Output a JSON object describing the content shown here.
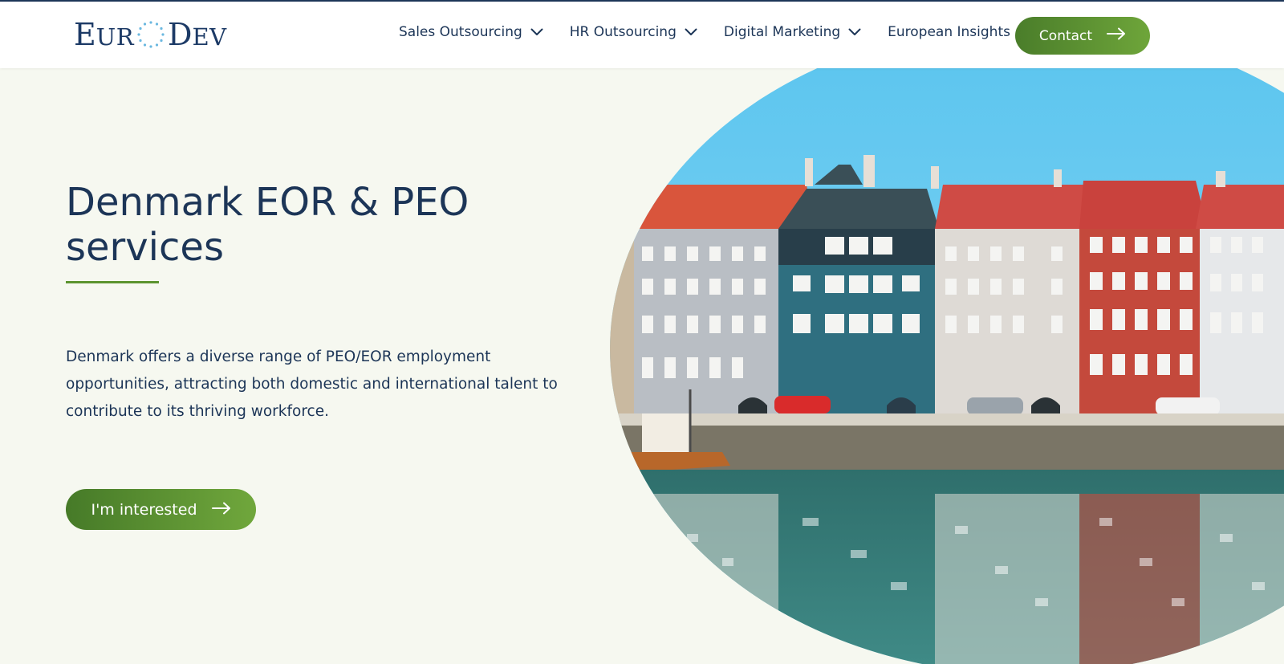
{
  "header": {
    "logo": {
      "part1_big": "E",
      "part1_small": "UR",
      "part2_big": "D",
      "part2_small": "EV"
    },
    "nav": [
      {
        "label": "Sales Outsourcing",
        "has_dropdown": true
      },
      {
        "label": "HR Outsourcing",
        "has_dropdown": true
      },
      {
        "label": "Digital Marketing",
        "has_dropdown": true
      },
      {
        "label": "European Insights",
        "has_dropdown": false
      }
    ],
    "contact_label": "Contact"
  },
  "hero": {
    "title": "Denmark EOR & PEO services",
    "description": "Denmark offers a diverse range of PEO/EOR employment opportunities, attracting both domestic and international talent to contribute to its thriving workforce.",
    "cta_label": "I'm interested",
    "image_icon": "nyhavn-harbor-photo"
  },
  "colors": {
    "navy": "#1c3557",
    "green_start": "#467a28",
    "green_end": "#70a73c",
    "background": "#f6f8f0",
    "logo_star": "#6bb8e0"
  },
  "icons": {
    "chevron": "chevron-down-icon",
    "arrow": "arrow-right-icon"
  }
}
